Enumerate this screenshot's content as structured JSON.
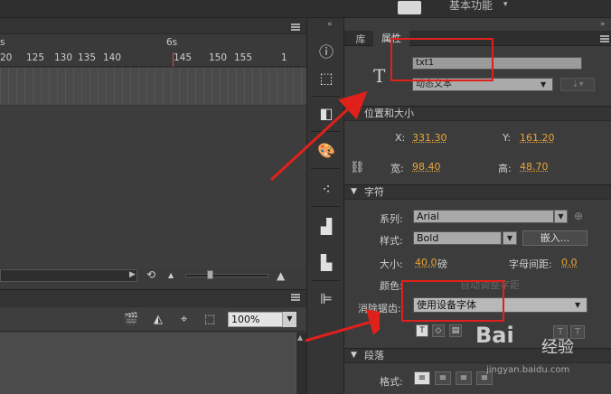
{
  "app": {
    "workspace_label": "基本功能",
    "workspace_arrow": "▾"
  },
  "timeline": {
    "ruler_second_label": "6s",
    "ruler_left_label": "s",
    "ruler_numbers": [
      "20",
      "125",
      "130",
      "135",
      "140",
      "145",
      "150",
      "155",
      "1"
    ],
    "loop_icon": "⟲",
    "zoom_small_icon": "▲",
    "zoom_large_icon": "▲"
  },
  "stage": {
    "zoom_value": "100%",
    "tools": [
      "clapper-icon",
      "paint-bucket-icon",
      "crosshair-icon",
      "frame-icon"
    ]
  },
  "toolstrip": {
    "icons": [
      "info-icon",
      "transform-icon",
      "library-icon",
      "palette-icon",
      "motion-icon",
      "align-icon",
      "distribute-icon",
      "components-icon"
    ]
  },
  "properties": {
    "tab_library": "库",
    "tab_properties": "属性",
    "text_tool_glyph": "T",
    "instance_name": "txt1",
    "text_type": "动态文本",
    "position_section": "位置和大小",
    "x_label": "X:",
    "x_value": "331.30",
    "y_label": "Y:",
    "y_value": "161.20",
    "width_label": "宽:",
    "width_value": "98.40",
    "height_label": "高:",
    "height_value": "48.70",
    "char_section": "字符",
    "family_label": "系列:",
    "family_value": "Arial",
    "style_label": "样式:",
    "style_value": "Bold",
    "embed_button": "嵌入...",
    "size_label": "大小:",
    "size_value": "40.0",
    "size_unit": "磅",
    "letter_spacing_label": "字母间距:",
    "letter_spacing_value": "0.0",
    "color_label": "颜色:",
    "auto_kern_label": "自动调整字距",
    "anti_alias_label": "消除锯齿:",
    "anti_alias_value": "使用设备字体",
    "paragraph_section": "段落",
    "format_label": "格式:"
  },
  "watermark": {
    "logo": "Bai",
    "sub": "经验",
    "url": "jingyan.baidu.com"
  },
  "colors": {
    "annotation_red": "#e0211b",
    "value_orange": "#e8a63a"
  }
}
